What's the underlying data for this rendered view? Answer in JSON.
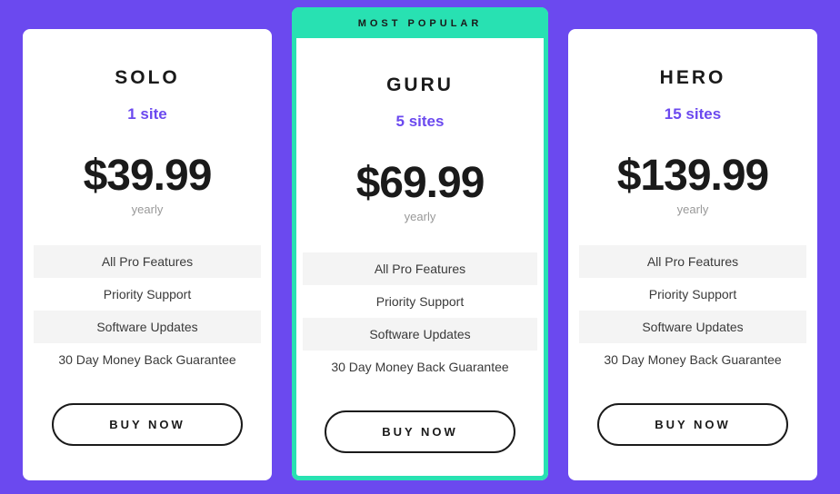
{
  "popular_label": "MOST POPULAR",
  "period_label": "yearly",
  "buy_label": "BUY NOW",
  "plans": [
    {
      "name": "SOLO",
      "sites": "1 site",
      "price": "$39.99",
      "features": [
        "All Pro Features",
        "Priority Support",
        "Software Updates",
        "30 Day Money Back Guarantee"
      ]
    },
    {
      "name": "GURU",
      "sites": "5 sites",
      "price": "$69.99",
      "features": [
        "All Pro Features",
        "Priority Support",
        "Software Updates",
        "30 Day Money Back Guarantee"
      ]
    },
    {
      "name": "HERO",
      "sites": "15 sites",
      "price": "$139.99",
      "features": [
        "All Pro Features",
        "Priority Support",
        "Software Updates",
        "30 Day Money Back Guarantee"
      ]
    }
  ]
}
